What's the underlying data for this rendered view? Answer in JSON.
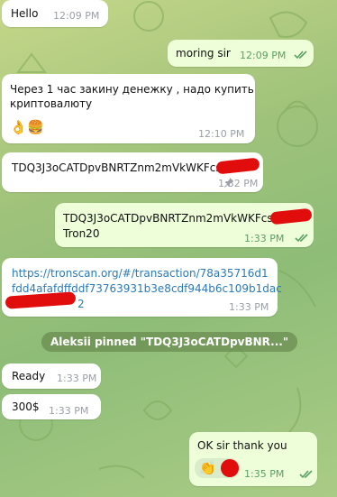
{
  "messages": [
    {
      "text": "Hello",
      "time": "12:09 PM"
    },
    {
      "text": "moring sir",
      "time": "12:09 PM"
    },
    {
      "line1": "Через 1 час закину денежку , надо купить",
      "line2": "криптовалюту",
      "time": "12:10 PM",
      "emojis": [
        "👌",
        "🍔"
      ]
    },
    {
      "text": "TDQ3J3oCATDpvBNRTZnm2mVkWKFcs",
      "time": "1:32 PM"
    },
    {
      "line1": "TDQ3J3oCATDpvBNRTZnm2mVkWKFcs",
      "line2": "Tron20",
      "time": "1:33 PM"
    },
    {
      "line1": "https://tronscan.org/#/transaction/78a35716d1",
      "line2": "fdd4afafdffddf73763931b3e8cdf944b6c109b1dac",
      "line3": "2",
      "time": "1:33 PM"
    },
    {
      "text": "Aleksii pinned \"TDQ3J3oCATDpvBNR...\""
    },
    {
      "text": "Ready",
      "time": "1:33 PM"
    },
    {
      "text": "300$",
      "time": "1:33 PM"
    },
    {
      "text": "OK sir thank you",
      "time": "1:35 PM",
      "reaction": "👏"
    }
  ],
  "colors": {
    "incoming": "#ffffff",
    "outgoing": "#eefed9",
    "link": "#2a7ab8",
    "redaction": "#e10d0d",
    "check": "#5aa063"
  }
}
